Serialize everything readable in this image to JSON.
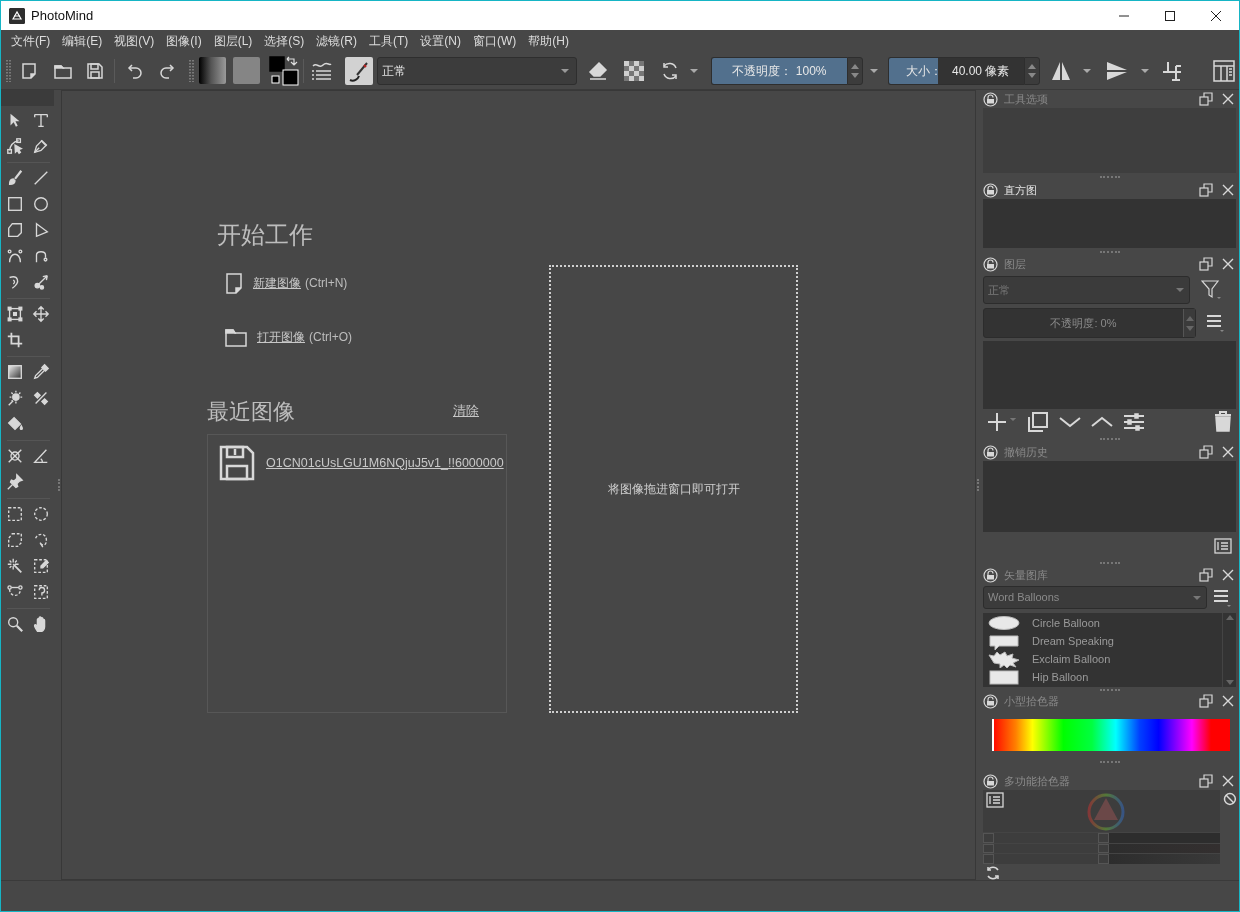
{
  "window": {
    "title": "PhotoMind"
  },
  "menu": [
    "文件(F)",
    "编辑(E)",
    "视图(V)",
    "图像(I)",
    "图层(L)",
    "选择(S)",
    "滤镜(R)",
    "工具(T)",
    "设置(N)",
    "窗口(W)",
    "帮助(H)"
  ],
  "toolbar": {
    "blend_mode": "正常",
    "opacity": {
      "label": "不透明度： 100%",
      "level": 1
    },
    "size": {
      "label": "大小：",
      "value": "40.00 像素",
      "level": 0.36
    }
  },
  "welcome": {
    "start_title": "开始工作",
    "actions": [
      {
        "kind": "new",
        "link": "新建图像",
        "shortcut": "(Ctrl+N)"
      },
      {
        "kind": "open",
        "link": "打开图像",
        "shortcut": "(Ctrl+O)"
      }
    ],
    "recent_title": "最近图像",
    "clear": "清除",
    "recent_files": [
      "O1CN01cUsLGU1M6NQjuJ5v1_!!6000000"
    ],
    "drop_hint": "将图像拖进窗口即可打开"
  },
  "dockers": [
    {
      "kind": "tool_options",
      "title": "工具选项",
      "active": false
    },
    {
      "kind": "histogram",
      "title": "直方图",
      "active": true
    },
    {
      "kind": "layers",
      "title": "图层",
      "active": false,
      "blend_mode": "正常",
      "opacity": "不透明度: 0%"
    },
    {
      "kind": "undo_history",
      "title": "撤销历史",
      "active": false
    },
    {
      "kind": "vector_library",
      "title": "矢量图库",
      "active": false,
      "collection": "Word Balloons",
      "items": [
        "Circle Balloon",
        "Dream Speaking",
        "Exclaim Balloon",
        "Hip Balloon"
      ]
    },
    {
      "kind": "small_color_selector",
      "title": "小型拾色器",
      "active": false,
      "level": 0
    },
    {
      "kind": "advanced_color_selector",
      "title": "多功能拾色器",
      "active": false
    }
  ]
}
